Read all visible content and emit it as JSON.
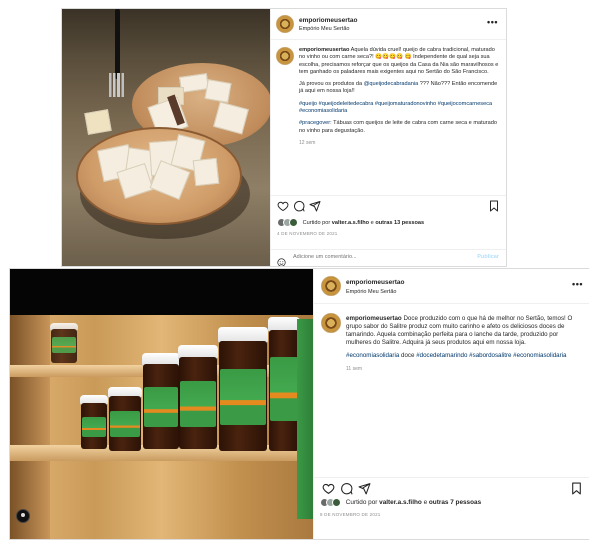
{
  "posts": [
    {
      "username": "emporiomeusertao",
      "location": "Empório Meu Sertão",
      "caption_user": "emporiomeusertao",
      "caption_p1": "Aquela dúvida cruel! queijo de cabra tradicional, maturado no vinho ou com carne seca?! 😋😋😋😋 😋 Independente de qual seja sua escolha, precisamos reforçar que os queijos da Casa da Nia são maravilhosos e tem ganhado os paladares mais exigentes aqui no Sertão do São Francisco.",
      "caption_p2_a": "Já provou os produtos da ",
      "caption_p2_mention": "@queijodecabradania",
      "caption_p2_b": " ??? Não??? Então encomende já aqui em nossa loja!!",
      "hashtags": "#queijo #queijodeleitedecabra #queijomaturadonovinho #queijocomcarneseca #economiasolidaria",
      "pracegover_tag": "#pracegover",
      "pracegover_text": ": Tábuas com queijos de leite de cabra com carne seca e maturado no vinho para degustação.",
      "time": "12 sem",
      "liked_by_prefix": "Curtido por ",
      "liked_by_user": "valter.a.s.filho",
      "liked_by_mid": " e ",
      "liked_by_others": "outras 13 pessoas",
      "date": "4 DE NOVEMBRO DE 2021",
      "comment_placeholder": "Adicione um comentário...",
      "publish": "Publicar"
    },
    {
      "username": "emporiomeusertao",
      "location": "Empório Meu Sertão",
      "caption_user": "emporiomeusertao",
      "caption_p1": "Doce produzido com o que há de melhor no Sertão, temos! O grupo sabor do Salitre produz com muito carinho e afeto os deliciosos doces de tamarindo. Aquela combinação perfeita para o lanche da tarde, produzido por mulheres do Salitre. Adquira já seus produtos aqui em nossa loja.",
      "hashtags_a": "#economiasolidaria",
      "hashtags_plain": " doce ",
      "hashtags_b": "#docedetamarindo #sabordosalitre #economiasolidaria",
      "time": "11 sem",
      "liked_by_prefix": "Curtido por ",
      "liked_by_user": "valter.a.s.filho",
      "liked_by_mid": " e ",
      "liked_by_others": "outras 7 pessoas",
      "date": "8 DE NOVEMBRO DE 2021"
    }
  ],
  "icons": [
    "more-icon",
    "heart-icon",
    "comment-icon",
    "share-icon",
    "bookmark-icon",
    "emoji-icon",
    "profile-tag-icon"
  ],
  "colors": {
    "link": "#00376b",
    "muted": "#8e8e8e",
    "border": "#dbdbdb",
    "publish": "#b2dffc"
  }
}
